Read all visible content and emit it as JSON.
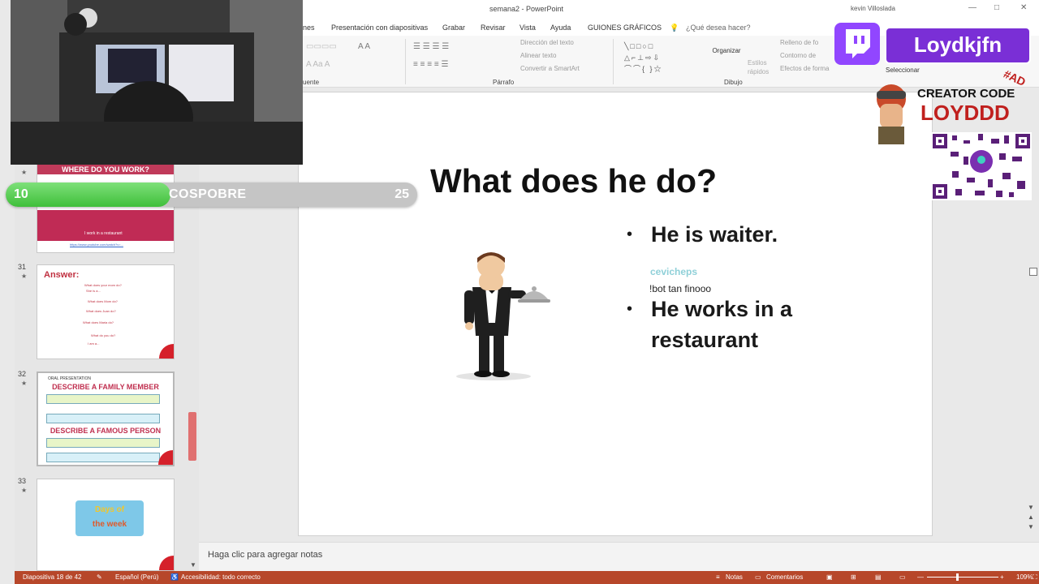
{
  "window": {
    "title": "semana2 - PowerPoint",
    "user": "kevin Villoslada",
    "controls": [
      "—",
      "□",
      "✕"
    ]
  },
  "ribbon_tabs": [
    "nes",
    "Presentación con diapositivas",
    "Grabar",
    "Revisar",
    "Vista",
    "Ayuda",
    "GUIONES GRÁFICOS",
    "¿Qué desea hacer?"
  ],
  "ribbon": {
    "paragraph_group": "Párrafo",
    "font_group": "uente",
    "drawing_group": "Dibujo",
    "text_direction": "Dirección del texto",
    "align_text": "Alinear texto",
    "smartart": "Convertir a SmartArt",
    "arrange": "Organizar",
    "quick_styles": "Estilos rápidos",
    "shape_fill": "Relleno de fo",
    "shape_outline": "Contorno de",
    "shape_effects": "Efectos de forma",
    "select": "Seleccionar"
  },
  "thumbnails": [
    {
      "number": "",
      "title": "WHERE DO YOU WORK?",
      "caption": "I work in a restaurant",
      "link": "https://www.youtube.com/watch?v=..."
    },
    {
      "number": "31",
      "title": "Answer:",
      "lines": [
        "What does your mom do?",
        "She is a...",
        "What does Mom do?",
        "What does Juan do?",
        "What does Maria do?",
        "What do you do?",
        "I am a..."
      ]
    },
    {
      "number": "32",
      "small": "ORAL PRESENTATION",
      "heading1": "DESCRIBE A FAMILY MEMBER",
      "heading2": "DESCRIBE A FAMOUS PERSON"
    },
    {
      "number": "33",
      "badge_line1": "Days of",
      "badge_line2": "the week"
    }
  ],
  "slide": {
    "title": "What does he do?",
    "bullets": [
      "He is waiter.",
      "He works in a",
      "restaurant"
    ]
  },
  "chat": {
    "user": "cevicheps",
    "message": "!bot tan finooo"
  },
  "notes_placeholder": "Haga clic para agregar notas",
  "statusbar": {
    "slide_info": "Diapositiva 18 de 42",
    "language": "Español (Perú)",
    "accessibility": "Accesibilidad: todo correcto",
    "notes": "Notas",
    "comments": "Comentarios",
    "zoom": "109%"
  },
  "stream": {
    "goal_current": "10",
    "goal_label": "COSPOBRE",
    "goal_target": "25",
    "goal_progress": 0.4,
    "twitch_name": "Loydkjfn",
    "creator_label": "CREATOR CODE",
    "creator_code": "LOYDDD",
    "ad_tag": "#AD",
    "colors": {
      "twitch": "#9146ff",
      "progress": "#4fcf4a",
      "statusbar": "#b7472a"
    }
  }
}
